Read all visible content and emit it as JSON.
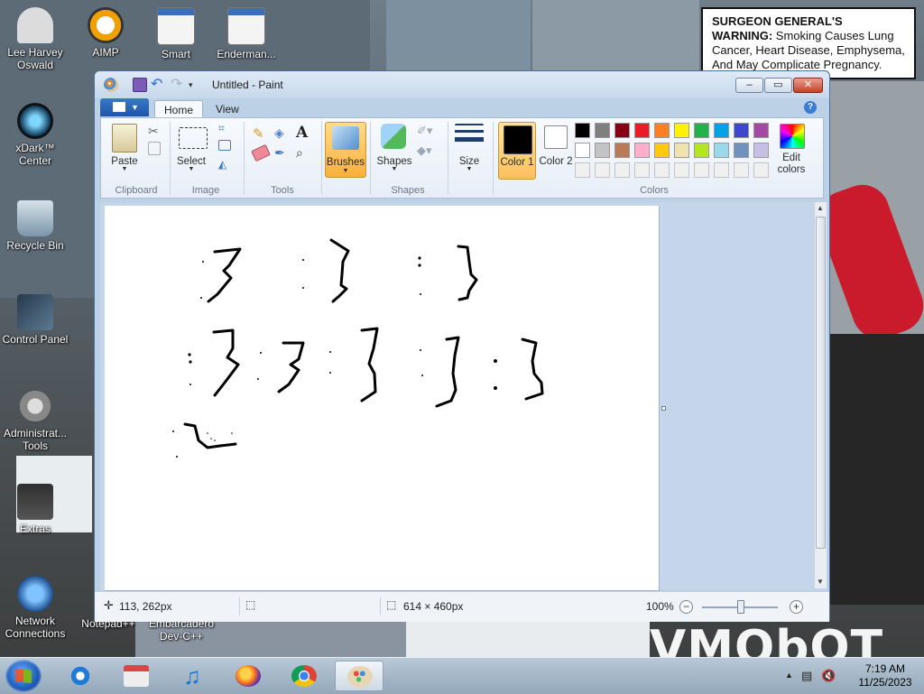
{
  "desktop": {
    "icons": [
      {
        "label": "Lee Harvey Oswald"
      },
      {
        "label": "AIMP"
      },
      {
        "label": "Smart"
      },
      {
        "label": "Enderman..."
      },
      {
        "label": "xDark™ Center"
      },
      {
        "label": "Recycle Bin"
      },
      {
        "label": "Control Panel"
      },
      {
        "label": "Administrat... Tools"
      },
      {
        "label": "Extras"
      },
      {
        "label": "Network Connections"
      },
      {
        "label": "Notepad++"
      },
      {
        "label": "Embarcadero Dev-C++"
      }
    ],
    "warning": {
      "heading": "SURGEON GENERAL'S WARNING:",
      "body": "Smoking Causes Lung Cancer, Heart Disease, Emphysema, And May Complicate Pregnancy."
    },
    "background_text": "VMObOT"
  },
  "paint": {
    "title": "Untitled - Paint",
    "tabs": [
      "Home",
      "View"
    ],
    "groups": {
      "clipboard": {
        "label": "Clipboard",
        "paste": "Paste"
      },
      "image": {
        "label": "Image",
        "select": "Select"
      },
      "tools": {
        "label": "Tools"
      },
      "brushes": {
        "label": "Brushes"
      },
      "shapes": {
        "label": "Shapes",
        "button": "Shapes"
      },
      "size": {
        "label": "Size"
      },
      "colors": {
        "label": "Colors",
        "color1": "Color 1",
        "color2": "Color 2",
        "edit": "Edit colors"
      }
    },
    "palette": [
      "#000000",
      "#7f7f7f",
      "#880015",
      "#ed1c24",
      "#ff7f27",
      "#fff200",
      "#22b14c",
      "#00a2e8",
      "#3f48cc",
      "#a349a4",
      "#ffffff",
      "#c3c3c3",
      "#b97a57",
      "#ffaec9",
      "#ffc90e",
      "#efe4b0",
      "#b5e61d",
      "#99d9ea",
      "#7092be",
      "#c8bfe7"
    ],
    "color1": "#000000",
    "color2": "#ffffff",
    "status": {
      "cursor": "113, 262px",
      "canvas_size": "614 × 460px",
      "zoom": "100%"
    }
  },
  "taskbar": {
    "time": "7:19 AM",
    "date": "11/25/2023"
  }
}
